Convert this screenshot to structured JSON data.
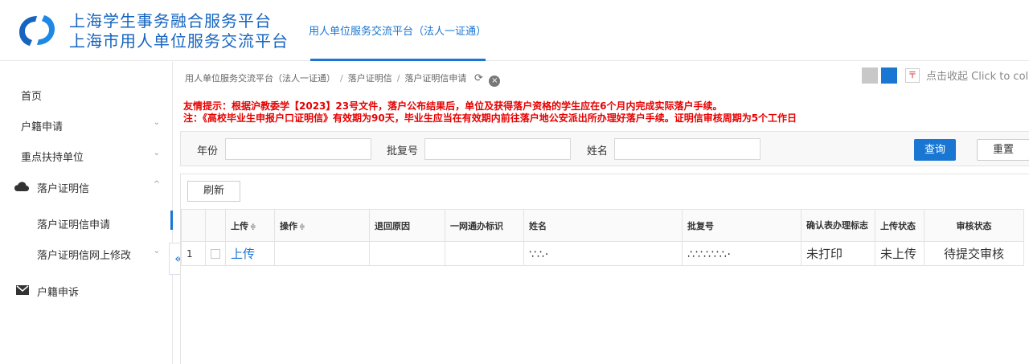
{
  "header": {
    "brand_line1": "上海学生事务融合服务平台",
    "brand_line2": "上海市用人单位服务交流平台",
    "tab": "用人单位服务交流平台（法人一证通）",
    "accent_color": "#1976d2"
  },
  "sidebar": {
    "items": [
      {
        "label": "首页",
        "icon": null,
        "chevron": null
      },
      {
        "label": "户籍申请",
        "icon": null,
        "chevron": "⌄"
      },
      {
        "label": "重点扶持单位",
        "icon": null,
        "chevron": "⌄"
      },
      {
        "label": "落户证明信",
        "icon": "cloud-icon",
        "chevron": "^"
      },
      {
        "label": "落户证明信申请",
        "icon": null,
        "chevron": null,
        "active": true
      },
      {
        "label": "落户证明信网上修改",
        "icon": null,
        "chevron": "⌄"
      },
      {
        "label": "户籍申诉",
        "icon": "envelope-icon",
        "chevron": null
      }
    ],
    "collapse_glyph": "«"
  },
  "breadcrumb": {
    "items": [
      "用人单位服务交流平台（法人一证通）",
      "落户证明信",
      "落户证明信申请"
    ],
    "separator": "/",
    "refresh_glyph": "⟳",
    "close_glyph": "×"
  },
  "topbar": {
    "collapse_icon": "〒",
    "collapse_text": "点击收起 Click to col"
  },
  "notice": {
    "line1": "友情提示：根据沪教委学【2023】23号文件，落户公布结果后，单位及获得落户资格的学生应在6个月内完成实际落户手续。",
    "line2": "注：《高校毕业生申报户口证明信》有效期为90天，毕业生应当在有效期内前往落户地公安派出所办理好落户手续。证明信审核周期为5个工作日",
    "color": "#e60000"
  },
  "filter": {
    "year_label": "年份",
    "year_value": "",
    "batch_label": "批复号",
    "batch_value": "",
    "name_label": "姓名",
    "name_value": "",
    "query_button": "查询",
    "reset_button": "重置"
  },
  "grid": {
    "refresh_button": "刷新",
    "sort_glyph": "≑",
    "columns": [
      "",
      "",
      "上传",
      "操作",
      "退回原因",
      "一网通办标识",
      "姓名",
      "批复号",
      "确认表办理标志",
      "上传状态",
      "审核状态"
    ],
    "rows": [
      {
        "index": "1",
        "upload": "上传",
        "action": "",
        "return_reason": "",
        "one_net_flag": "",
        "name": "∵∴·",
        "batch_no": "∴∵∴∵∴·",
        "confirm_flag": "未打印",
        "upload_status": "未上传",
        "review_status": "待提交审核"
      }
    ]
  }
}
